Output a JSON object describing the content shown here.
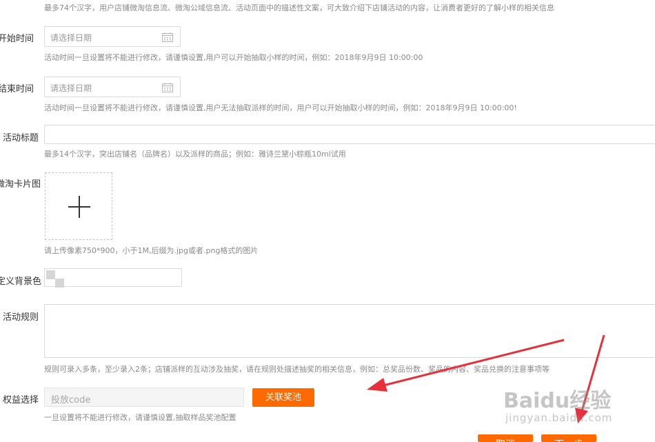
{
  "top_hint": "最多74个汉字，用户店铺微淘信息流、微淘公域信息流、活动页面中的描述性文案，可大致介绍下店铺活动的内容，让消费者更好的了解小样的相关信息",
  "start_time": {
    "label": "开始时间",
    "placeholder": "请选择日期",
    "hint": "活动时间一旦设置将不能进行修改，请谨慎设置,用户可以开始抽取小样的时间，例如：2018年9月9日 10:00:00"
  },
  "end_time": {
    "label": "结束时间",
    "placeholder": "请选择日期",
    "hint": "活动时间一旦设置将不能进行修改，请谨慎设置,用户无法抽取派样的时间，用户可以开始抽取小样的时间，例如：2018年9月9日 10:00:00!"
  },
  "activity_title": {
    "label": "活动标题",
    "value": "",
    "hint": "最多14个汉字，突出店铺名（品牌名）以及派样的商品；例如：雅诗兰黛小棕瓶10ml试用"
  },
  "card_image": {
    "label": "微淘卡片图",
    "hint": "请上传像素750*900，小于1M,后缀为.jpg或者.png格式的图片"
  },
  "background_color": {
    "label": "定义背景色"
  },
  "rules": {
    "label": "活动规则",
    "value": "",
    "hint": "规则可录入多条，至少录入2条；店铺派样的互动涉及抽奖，请在规则处描述抽奖的相关信息，例如：总奖品份数、奖品的内容、奖品兑换的注意事项等"
  },
  "benefit": {
    "label": "权益选择",
    "placeholder": "投放code",
    "button": "关联奖池",
    "hint": "一旦设置将不能进行修改，请谨慎设置,抽取样品奖池配置"
  },
  "footer_buttons": {
    "cancel": "取消",
    "next": "下一步"
  },
  "watermark": {
    "brand": "Baidu经验",
    "url": "jingyan.baidu.com"
  },
  "colors": {
    "accent": "#ff6a00",
    "annotation_arrow": "#e8303a"
  }
}
